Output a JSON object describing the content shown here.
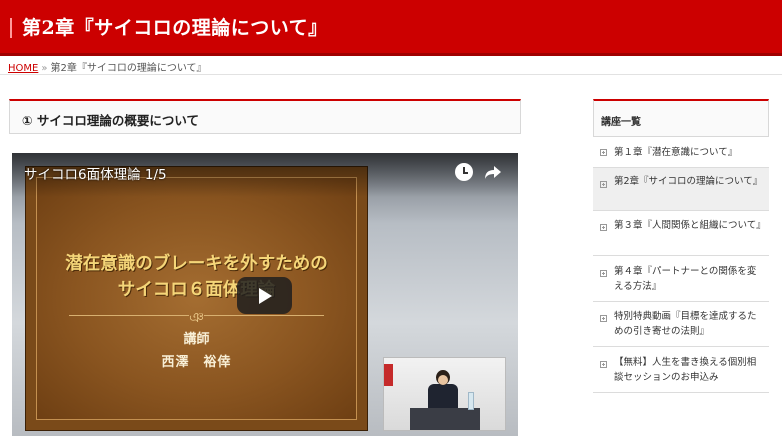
{
  "header": {
    "title": "第2章『サイコロの理論について』"
  },
  "breadcrumb": {
    "home": "HOME",
    "separator": "»",
    "current": "第2章『サイコロの理論について』"
  },
  "section": {
    "heading": "① サイコロ理論の概要について"
  },
  "video": {
    "title": "サイコロ6面体理論 1/5",
    "slide_line1": "潜在意識のブレーキを外すための",
    "slide_line2": "サイコロ６面体理論",
    "ornament": "ঞ",
    "lecturer_label": "講師",
    "lecturer_name": "西澤　裕倖"
  },
  "sidebar": {
    "heading": "講座一覧",
    "items": [
      {
        "label": "第１章『潜在意識について』"
      },
      {
        "label": "第2章『サイコロの理論について』"
      },
      {
        "label": "第３章『人間関係と組織について』"
      },
      {
        "label": "第４章『パートナーとの関係を変える方法』"
      },
      {
        "label": "特別特典動画『目標を達成するための引き寄せの法則』"
      },
      {
        "label": "【無料】人生を書き換える個別相談セッションのお申込み"
      }
    ]
  },
  "colors": {
    "brand_red": "#cc0000",
    "slide_gold": "#f5d679"
  }
}
